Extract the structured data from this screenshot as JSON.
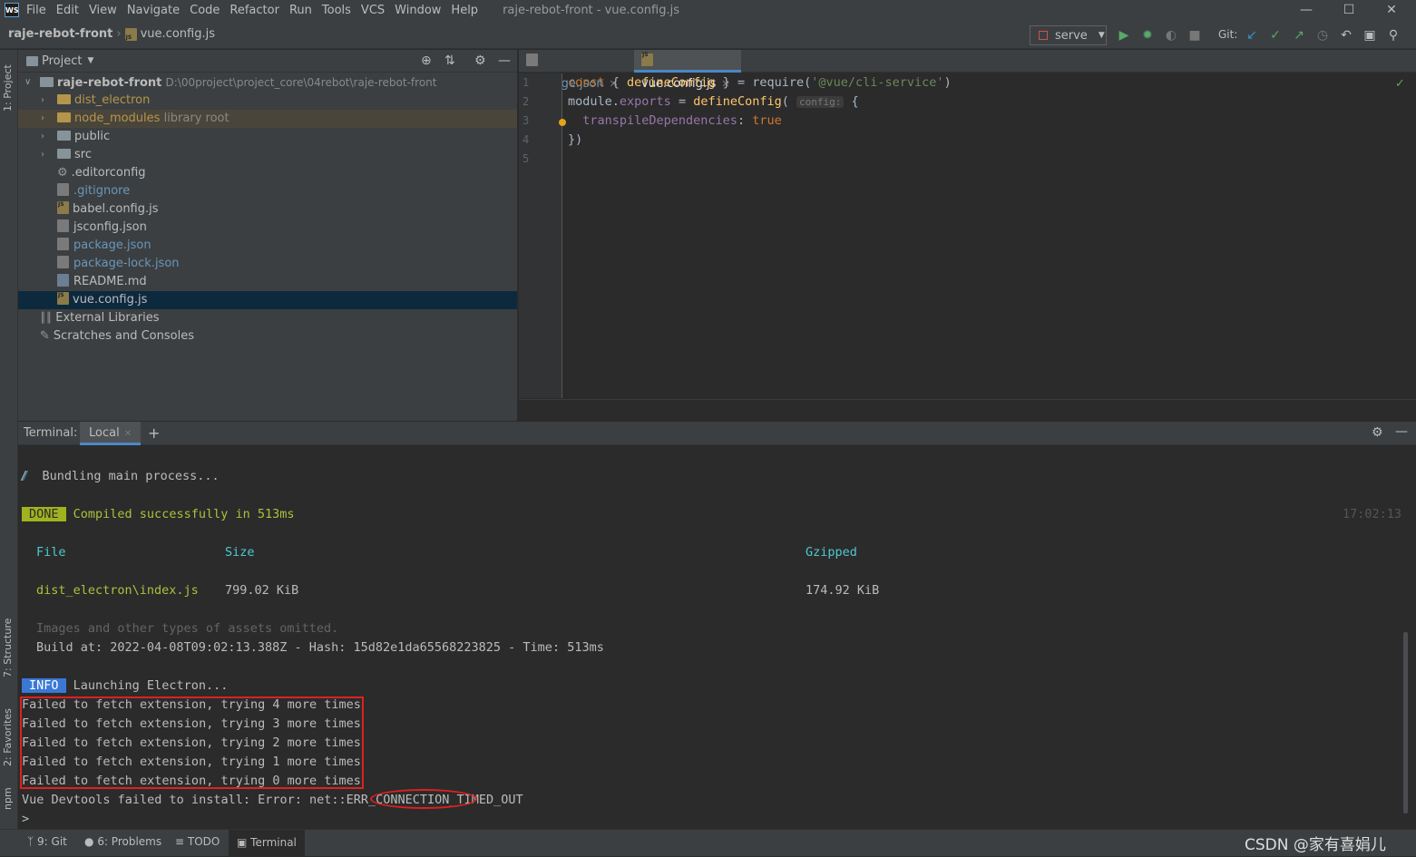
{
  "menu": {
    "items": [
      "File",
      "Edit",
      "View",
      "Navigate",
      "Code",
      "Refactor",
      "Run",
      "Tools",
      "VCS",
      "Window",
      "Help"
    ],
    "window_title": "raje-rebot-front - vue.config.js",
    "logo": "WS"
  },
  "nav": {
    "project": "raje-rebot-front",
    "file": "vue.config.js",
    "run_config": "serve",
    "git_label": "Git:"
  },
  "side_tabs": {
    "project": "1: Project",
    "structure": "7: Structure",
    "favorites": "2: Favorites",
    "npm": "npm"
  },
  "project_panel": {
    "title": "Project",
    "root_name": "raje-rebot-front",
    "root_path": "D:\\00project\\project_core\\04rebot\\raje-rebot-front",
    "items": [
      {
        "label": "dist_electron",
        "note": ""
      },
      {
        "label": "node_modules",
        "note": "library root"
      },
      {
        "label": "public",
        "note": ""
      },
      {
        "label": "src",
        "note": ""
      },
      {
        "label": ".editorconfig",
        "note": ""
      },
      {
        "label": ".gitignore",
        "note": ""
      },
      {
        "label": "babel.config.js",
        "note": ""
      },
      {
        "label": "jsconfig.json",
        "note": ""
      },
      {
        "label": "package.json",
        "note": ""
      },
      {
        "label": "package-lock.json",
        "note": ""
      },
      {
        "label": "README.md",
        "note": ""
      },
      {
        "label": "vue.config.js",
        "note": ""
      },
      {
        "label": "External Libraries",
        "note": ""
      },
      {
        "label": "Scratches and Consoles",
        "note": ""
      }
    ]
  },
  "editor": {
    "tabs": [
      "package.json",
      "vue.config.js"
    ],
    "line_numbers": [
      "1",
      "2",
      "3",
      "4",
      "5"
    ],
    "code": {
      "l1_kw": "const",
      "l1_a": " { ",
      "l1_fn": "defineConfig",
      "l1_b": " } = require(",
      "l1_str": "'@vue/cli-service'",
      "l1_c": ")",
      "l2_a": "module.",
      "l2_prop": "exports",
      "l2_b": " = ",
      "l2_fn": "defineConfig",
      "l2_c": "( ",
      "l2_hint": "config:",
      "l2_d": " {",
      "l3_prop": "  transpileDependencies",
      "l3_a": ": ",
      "l3_kw": "true",
      "l4": "})"
    }
  },
  "terminal": {
    "label": "Terminal:",
    "tab": "Local",
    "lines": {
      "bundling": "/  Bundling main process...",
      "done_badge": "DONE",
      "compiled": "Compiled successfully in 513ms",
      "timestamp": "17:02:13",
      "col_file": "File",
      "col_size": "Size",
      "col_gzip": "Gzipped",
      "row_file": "dist_electron\\index.js",
      "row_size": "799.02 KiB",
      "row_gzip": "174.92 KiB",
      "omitted": "Images and other types of assets omitted.",
      "build": "Build at: 2022-04-08T09:02:13.388Z - Hash: 15d82e1da65568223825 - Time: 513ms",
      "info_badge": "INFO",
      "launching": "Launching Electron...",
      "fail4": "Failed to fetch extension, trying 4 more times",
      "fail3": "Failed to fetch extension, trying 3 more times",
      "fail2": "Failed to fetch extension, trying 2 more times",
      "fail1": "Failed to fetch extension, trying 1 more times",
      "fail0": "Failed to fetch extension, trying 0 more times",
      "error": "Vue Devtools failed to install: Error: net::ERR_CONNECTION_TIMED_OUT",
      "prompt": ">"
    }
  },
  "statusbar": {
    "git": "9: Git",
    "problems": "6: Problems",
    "todo": "TODO",
    "terminal": "Terminal"
  },
  "watermark": "CSDN @家有喜娟儿"
}
